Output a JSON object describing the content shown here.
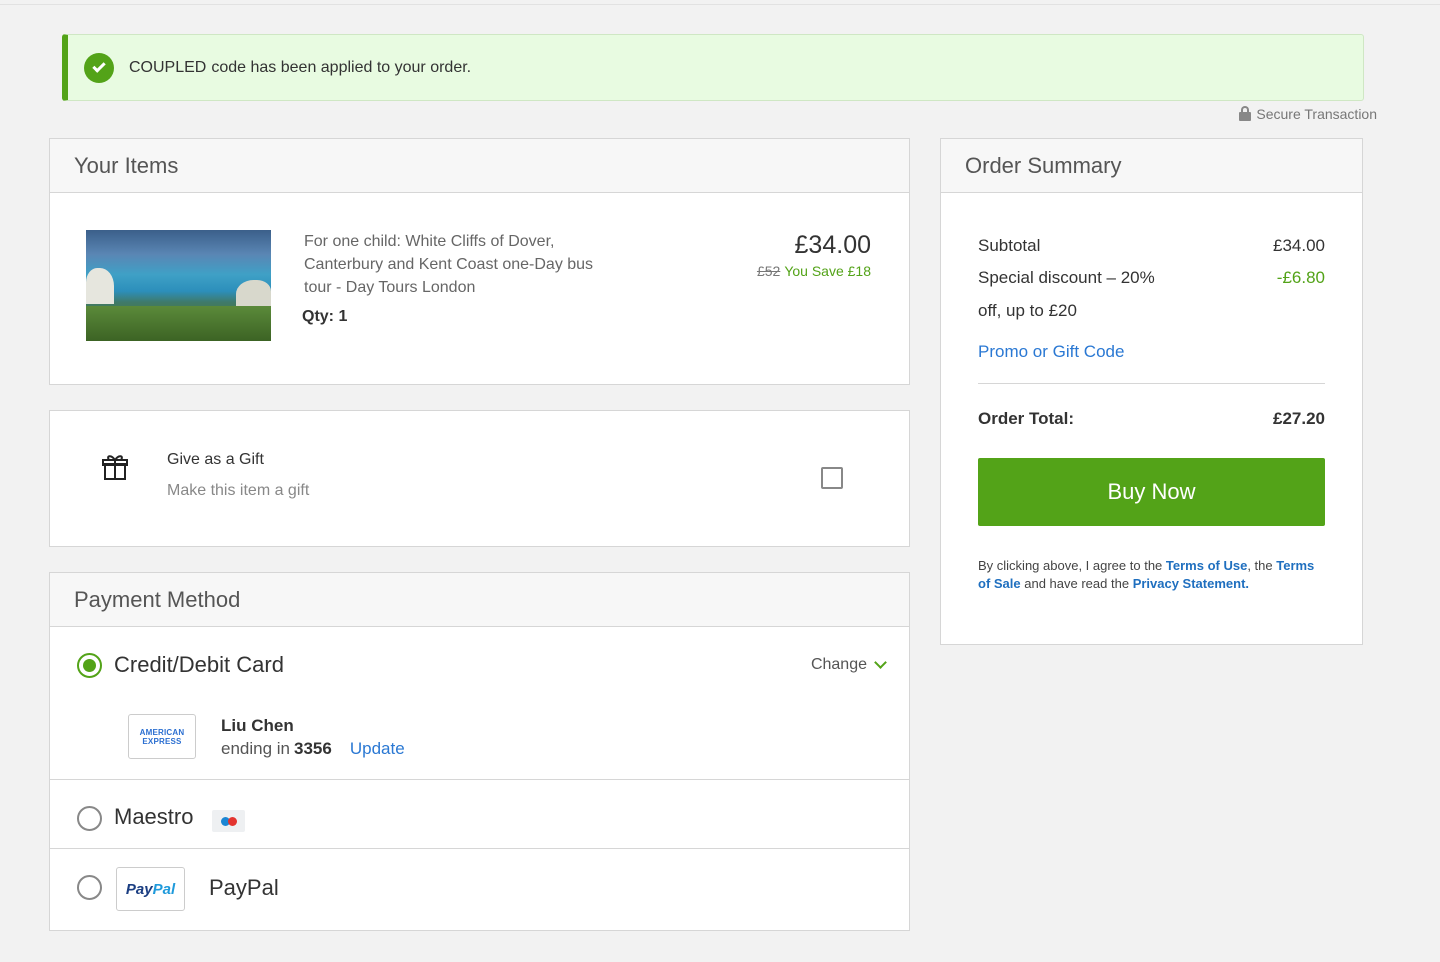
{
  "alert": {
    "code": "COUPLED",
    "message": "code has been applied to your order."
  },
  "secure": "Secure Transaction",
  "items": {
    "title": "Your Items",
    "item": {
      "description": "For one child: White Cliffs of Dover, Canterbury and Kent Coast one-Day bus tour - Day Tours London",
      "qty": "Qty: 1",
      "price": "£34.00",
      "original_price": "£52",
      "saving": "You Save £18"
    }
  },
  "gift": {
    "title": "Give as a Gift",
    "subtitle": "Make this item a gift",
    "checked": false
  },
  "payment": {
    "title": "Payment Method",
    "credit": {
      "label": "Credit/Debit Card",
      "change": "Change",
      "card_brand_line1": "AMERICAN",
      "card_brand_line2": "EXPRESS",
      "cardholder": "Liu Chen",
      "ending_label": "ending in",
      "last4": "3356",
      "update": "Update"
    },
    "maestro": {
      "label": "Maestro"
    },
    "paypal": {
      "label": "PayPal",
      "logo_part1": "Pay",
      "logo_part2": "Pal"
    }
  },
  "summary": {
    "title": "Order Summary",
    "subtotal_label": "Subtotal",
    "subtotal": "£34.00",
    "discount_label_1": "Special discount – 20%",
    "discount_label_2": "off, up to £20",
    "discount": "-£6.80",
    "promo_link": "Promo or Gift Code",
    "total_label": "Order Total:",
    "total": "£27.20",
    "buy_button": "Buy Now",
    "legal": {
      "t1": "By clicking above, I agree to the",
      "terms_of_use": "Terms of Use",
      "t2": ", the",
      "terms_of_sale": "Terms of Sale",
      "t3": "and have read the",
      "privacy": "Privacy Statement",
      "t4": "."
    }
  },
  "colors": {
    "accent_green": "#53a318",
    "link_blue": "#2a78d3",
    "alert_bg": "#e8fbe1"
  }
}
